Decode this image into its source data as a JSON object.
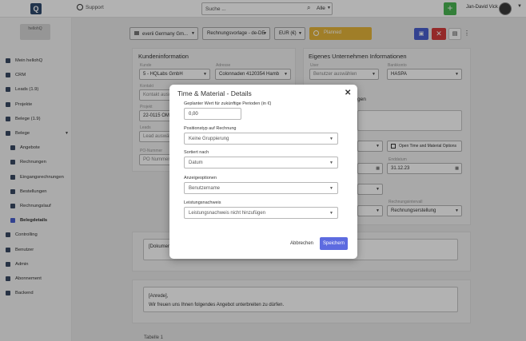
{
  "header": {
    "logo_text": "Q",
    "support": "Support",
    "search_placeholder": "Suche ...",
    "search_scope": "Alle",
    "add": "+",
    "user": "Jan-David Vick"
  },
  "sidebar": {
    "org_logo": "hellohQ",
    "items": [
      {
        "label": "Mein hellohQ",
        "icon": "person-icon"
      },
      {
        "label": "CRM",
        "icon": "crm-icon"
      },
      {
        "label": "Leads (1.9)",
        "icon": "leads-icon"
      },
      {
        "label": "Projekte",
        "icon": "projects-icon"
      },
      {
        "label": "Belege (1.9)",
        "icon": "receipts-icon"
      },
      {
        "label": "Belege",
        "icon": "documents-icon"
      },
      {
        "label": "Angebote",
        "icon": "offers-icon"
      },
      {
        "label": "Rechnungen",
        "icon": "invoices-icon"
      },
      {
        "label": "Eingangsrechnungen",
        "icon": "incoming-invoices-icon"
      },
      {
        "label": "Bestellungen",
        "icon": "orders-icon"
      },
      {
        "label": "Rechnungslauf",
        "icon": "invoice-run-icon"
      },
      {
        "label": "Belegdetails",
        "icon": "document-details-icon"
      },
      {
        "label": "Controlling",
        "icon": "controlling-icon"
      },
      {
        "label": "Benutzer",
        "icon": "users-icon"
      },
      {
        "label": "Admin",
        "icon": "admin-icon"
      },
      {
        "label": "Abonnement",
        "icon": "subscription-icon"
      },
      {
        "label": "Backend",
        "icon": "backend-icon"
      }
    ]
  },
  "toolbar": {
    "company": "everii Germany Gm...",
    "template": "Rechnungsvorlage - de-DE",
    "currency": "EUR (€)",
    "status": "Planned",
    "save_icon": "save-icon",
    "close": "✕",
    "chat_icon": "chat-icon",
    "more": "⋮"
  },
  "customer": {
    "title": "Kundeninformation",
    "kunde_label": "Kunde",
    "kunde": "5 - HQLabs GmbH",
    "adresse_label": "Adresse",
    "adresse": "Colonnaden 4120354 Hamb",
    "kontakt_label": "Kontakt",
    "kontakt": "Kontakt auswählen",
    "projekt_label": "Projekt",
    "projekt": "22-0115 OM",
    "lead_label": "Leads",
    "lead": "Lead auswählen",
    "po_label": "PO-Nummer",
    "po": "PO Nummer"
  },
  "company_info": {
    "title": "Eigenes Unternehmen Informationen",
    "user_label": "User",
    "user": "Benutzer auswählen",
    "bank_label": "Bankkonto",
    "bank": "HASPA",
    "section_fragment": "gen",
    "tm_button": "Open Time and Material Options",
    "date_label": "Enddatum",
    "date": "31.12.23",
    "billing_label": "Rechnungsintervall",
    "billing": "Rechnungserstellung"
  },
  "doc_text": {
    "placeholder": "[Dokumen"
  },
  "intro": {
    "line1": "[Anrede],",
    "line2": "Wir freuen uns Ihnen folgendes Angebot unterbreiten zu dürfen."
  },
  "footer_label": "Tabelle 1",
  "modal": {
    "title": "Time & Material - Details",
    "close": "✕",
    "planned_label": "Geplanter Wert für zukünftige Perioden (in €)",
    "planned_value": "0,00",
    "position_label": "Positionstyp auf Rechnung",
    "position_value": "Keine Gruppierung",
    "sort_label": "Sortiert nach",
    "sort_value": "Datum",
    "display_label": "Anzeigeoptionen",
    "display_value": "Benutzername",
    "proof_label": "Leistungsnachweis",
    "proof_value": "Leistungsnachweis nicht hinzufügen",
    "cancel": "Abbrechen",
    "save": "Speichern"
  }
}
